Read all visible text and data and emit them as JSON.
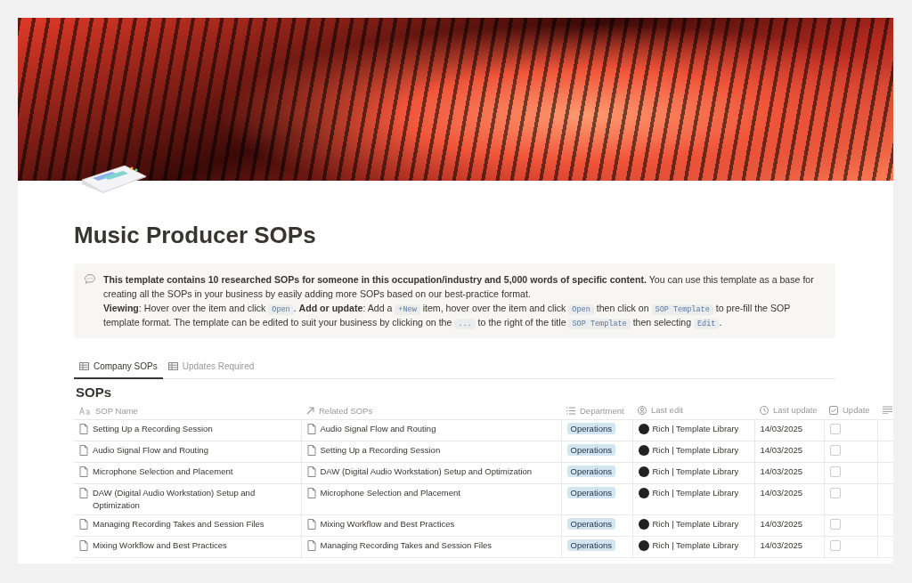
{
  "page": {
    "title": "Music Producer SOPs"
  },
  "callout": {
    "paragraphs": [
      [
        {
          "kind": "bold",
          "text": "This template contains 10 researched SOPs for someone in this occupation/industry and 5,000 words of specific content."
        },
        {
          "kind": "text",
          "text": " You can use this template as a base for creating all the SOPs in your business by easily adding more SOPs based on our best-practice format."
        }
      ],
      [
        {
          "kind": "bold",
          "text": "Viewing"
        },
        {
          "kind": "text",
          "text": ": Hover over the item and click "
        },
        {
          "kind": "code",
          "text": "Open"
        },
        {
          "kind": "text",
          "text": ". "
        },
        {
          "kind": "bold",
          "text": "Add or update"
        },
        {
          "kind": "text",
          "text": ": Add a "
        },
        {
          "kind": "code",
          "text": "+New"
        },
        {
          "kind": "text",
          "text": " item, hover over the item and click "
        },
        {
          "kind": "code",
          "text": "Open"
        },
        {
          "kind": "text",
          "text": " then click on "
        },
        {
          "kind": "code",
          "text": "SOP Template"
        },
        {
          "kind": "text",
          "text": " to pre-fill the SOP template format. The template can be edited to suit your business by clicking on the "
        },
        {
          "kind": "code",
          "text": "..."
        },
        {
          "kind": "text",
          "text": " to the right of the title "
        },
        {
          "kind": "code",
          "text": "SOP Template"
        },
        {
          "kind": "text",
          "text": " then selecting "
        },
        {
          "kind": "code",
          "text": "Edit"
        },
        {
          "kind": "text",
          "text": "."
        }
      ]
    ]
  },
  "tabs": [
    {
      "label": "Company SOPs",
      "selected": true
    },
    {
      "label": "Updates Required",
      "selected": false
    }
  ],
  "table": {
    "title": "SOPs",
    "columns": [
      {
        "kind": "title",
        "label": "SOP Name"
      },
      {
        "kind": "relation",
        "label": "Related SOPs"
      },
      {
        "kind": "select",
        "label": "Department"
      },
      {
        "kind": "person",
        "label": "Last edit"
      },
      {
        "kind": "date",
        "label": "Last update"
      },
      {
        "kind": "checkbox",
        "label": "Update"
      },
      {
        "kind": "text"
      }
    ],
    "rows": [
      {
        "name": "Setting Up a Recording Session",
        "related": "Audio Signal Flow and Routing",
        "department": "Operations",
        "last_edit": "Rich | Template Library",
        "last_update": "14/03/2025",
        "checked": false
      },
      {
        "name": "Audio Signal Flow and Routing",
        "related": "Setting Up a Recording Session",
        "department": "Operations",
        "last_edit": "Rich | Template Library",
        "last_update": "14/03/2025",
        "checked": false
      },
      {
        "name": "Microphone Selection and Placement",
        "related": "DAW (Digital Audio Workstation) Setup and Optimization",
        "department": "Operations",
        "last_edit": "Rich | Template Library",
        "last_update": "14/03/2025",
        "checked": false
      },
      {
        "name": "DAW (Digital Audio Workstation) Setup and Optimization",
        "related": "Microphone Selection and Placement",
        "department": "Operations",
        "last_edit": "Rich | Template Library",
        "last_update": "14/03/2025",
        "checked": false
      },
      {
        "name": "Managing Recording Takes and Session Files",
        "related": "Mixing Workflow and Best Practices",
        "department": "Operations",
        "last_edit": "Rich | Template Library",
        "last_update": "14/03/2025",
        "checked": false
      },
      {
        "name": "Mixing Workflow and Best Practices",
        "related": "Managing Recording Takes and Session Files",
        "department": "Operations",
        "last_edit": "Rich | Template Library",
        "last_update": "14/03/2025",
        "checked": false
      }
    ]
  }
}
